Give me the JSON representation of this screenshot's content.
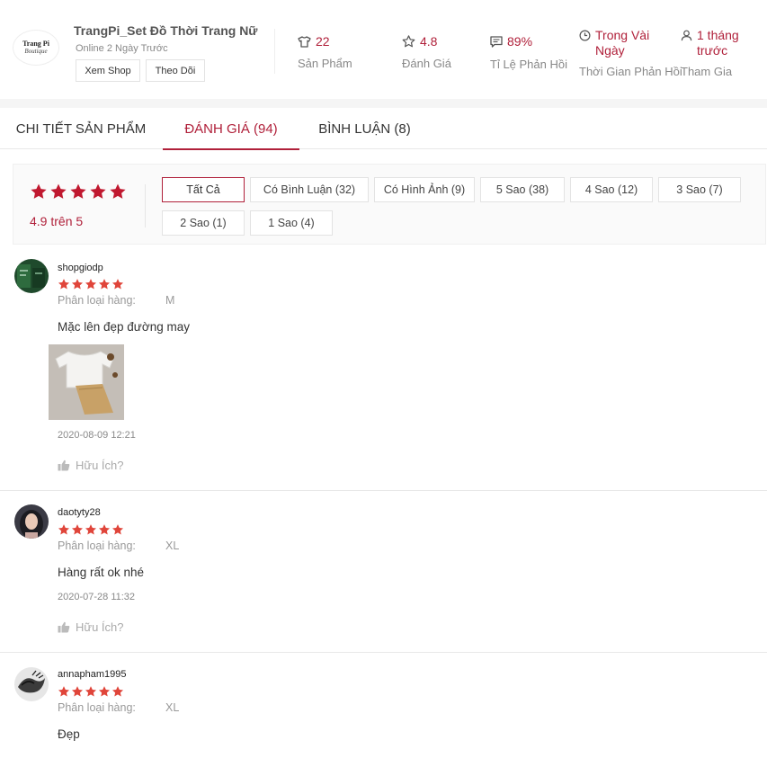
{
  "shop": {
    "logo_line1": "Trang Pi",
    "logo_line2": "Boutique",
    "name": "TrangPi_Set Đồ Thời Trang Nữ",
    "status": "Online 2 Ngày Trước",
    "view_shop_label": "Xem Shop",
    "follow_label": "Theo Dõi",
    "stats": {
      "products": {
        "icon": "shirt-icon",
        "value": "22",
        "label": "Sản Phẩm"
      },
      "rating": {
        "icon": "star-outline-icon",
        "value": "4.8",
        "label": "Đánh Giá"
      },
      "reply_rate": {
        "icon": "chat-icon",
        "value": "89%",
        "label": "Tỉ Lệ Phản Hồi"
      },
      "reply_time": {
        "icon": "clock-icon",
        "value": "Trong Vài Ngày",
        "label": "Thời Gian Phản Hồi"
      },
      "joined": {
        "icon": "person-icon",
        "value": "1 tháng trước",
        "label": "Tham Gia"
      }
    }
  },
  "tabs": [
    {
      "label": "CHI TIẾT SẢN PHẨM"
    },
    {
      "label": "ĐÁNH GIÁ (94)",
      "active": true
    },
    {
      "label": "BÌNH LUẬN (8)"
    }
  ],
  "summary": {
    "stars": 5,
    "score_text": "4.9 trên 5",
    "filters": [
      {
        "label": "Tất Cả",
        "active": true
      },
      {
        "label": "Có Bình Luận (32)"
      },
      {
        "label": "Có Hình Ảnh (9)"
      },
      {
        "label": "5 Sao (38)"
      },
      {
        "label": "4 Sao (12)"
      },
      {
        "label": "3 Sao (7)"
      },
      {
        "label": "2 Sao (1)"
      },
      {
        "label": "1 Sao (4)"
      }
    ]
  },
  "variant_label": "Phân loại hàng:",
  "helpful_label": "Hữu Ích?",
  "reviews": [
    {
      "username": "shopgiodp",
      "stars": 5,
      "variant": "M",
      "comment": "Mặc lên đẹp đường may",
      "has_photo": true,
      "date": "2020-08-09 12:21"
    },
    {
      "username": "daotyty28",
      "stars": 5,
      "variant": "XL",
      "comment": "Hàng rất ok nhé",
      "has_photo": false,
      "date": "2020-07-28 11:32"
    },
    {
      "username": "annapham1995",
      "stars": 5,
      "variant": "XL",
      "comment": "Đẹp",
      "has_photo": false
    }
  ],
  "colors": {
    "accent": "#b0203a",
    "star": "#e0453a"
  }
}
